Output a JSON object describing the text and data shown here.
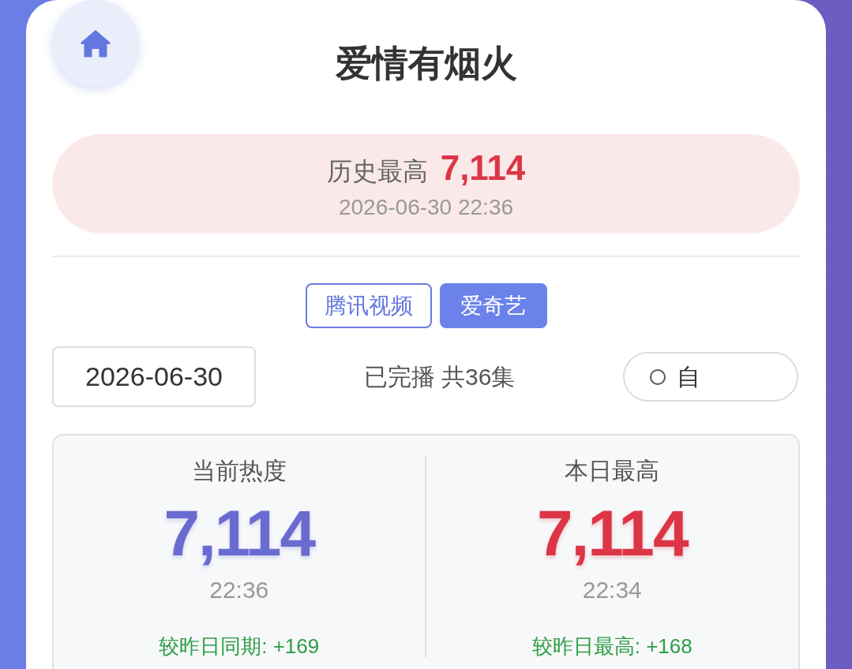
{
  "header": {
    "title": "爱情有烟火"
  },
  "record": {
    "label": "历史最高",
    "value": "7,114",
    "time": "2026-06-30 22:36"
  },
  "platform_tabs": [
    {
      "label": "腾讯视频",
      "selected": false
    },
    {
      "label": "爱奇艺",
      "selected": true
    }
  ],
  "filters": {
    "date_field": {
      "value": "2026-06-30"
    },
    "status": "已完播 共36集",
    "radio_option": {
      "label": "自",
      "checked": false
    }
  },
  "stats": [
    {
      "label": "当前热度",
      "value": "7,114",
      "time": "22:36",
      "comparison": "较昨日同期: +169",
      "color": "#6a6bd0"
    },
    {
      "label": "本日最高",
      "value": "7,114",
      "time": "22:34",
      "comparison": "较昨日最高: +168",
      "color": "#dc3545"
    }
  ]
}
